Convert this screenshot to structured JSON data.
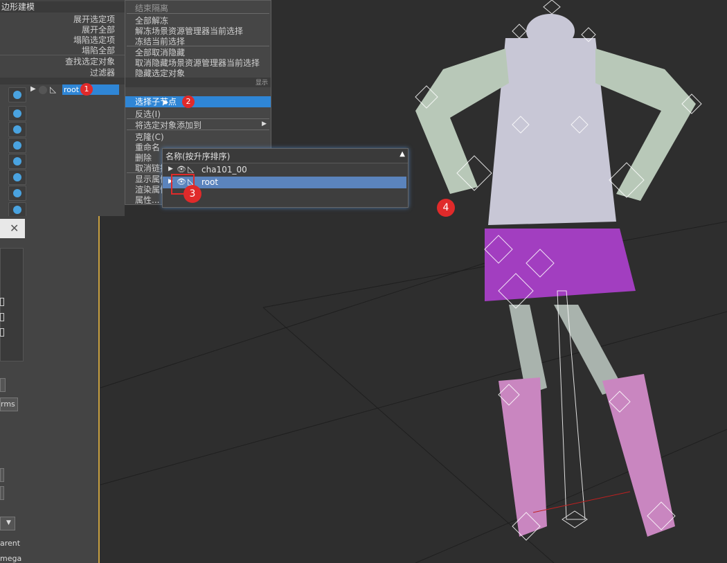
{
  "left_panel": {
    "title": "边形建模",
    "items": [
      "展开选定项",
      "展开全部",
      "塌陷选定项",
      "塌陷全部",
      "查找选定对象",
      "过滤器"
    ],
    "tree_node_label": "root"
  },
  "context_menu": {
    "top_partial": [
      "结束隔离"
    ],
    "group1": [
      "全部解冻",
      "解冻场景资源管理器当前选择",
      "冻结当前选择"
    ],
    "group2": [
      "全部取消隐藏",
      "取消隐藏场景资源管理器当前选择",
      "隐藏选定对象"
    ],
    "right_hint": "显示",
    "highlight": "选择子节点",
    "group3": [
      "反选(I)",
      "将选定对象添加到"
    ],
    "group4": [
      "克隆(C)",
      "重命名",
      "删除",
      "取消链接"
    ],
    "group5": [
      "显示属性",
      "渲染属性",
      "属性..."
    ]
  },
  "picker": {
    "header": "名称(按升序排序)",
    "rows": [
      {
        "label": "cha101_00",
        "selected": false
      },
      {
        "label": "root",
        "selected": true
      }
    ]
  },
  "badges": [
    "1",
    "2",
    "3",
    "4"
  ],
  "bottom_left": {
    "labels": [
      "rms",
      "arent",
      "mega"
    ]
  },
  "colors": {
    "accent": "#2f86d6",
    "badge": "#e02a2a"
  }
}
